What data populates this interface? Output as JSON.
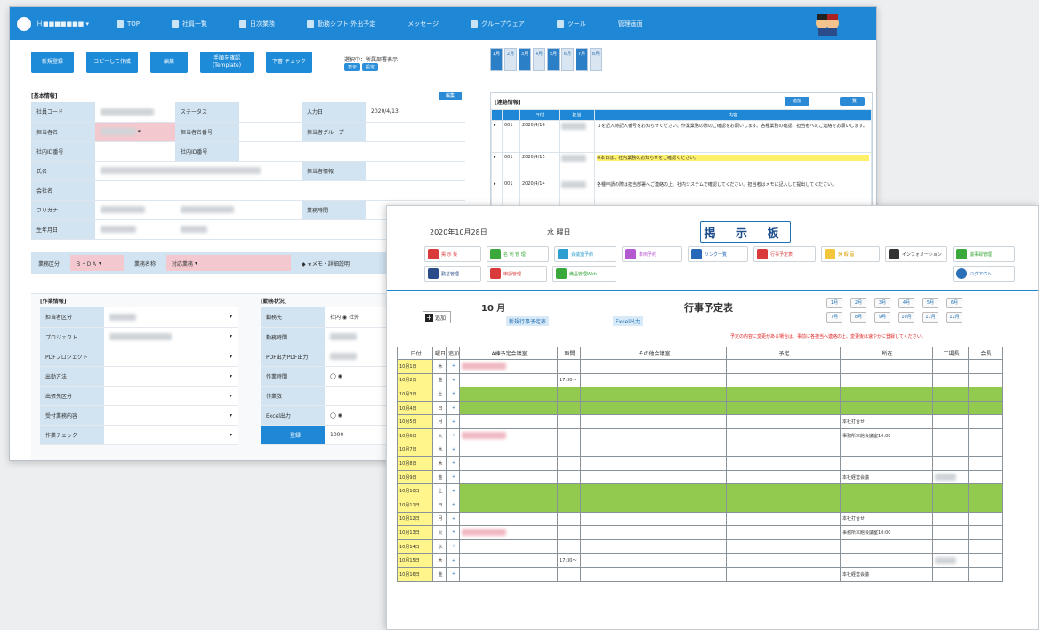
{
  "app": {
    "nav": {
      "user": "Ｈ■■■■■■■ ▾",
      "items": [
        "TOP",
        "社員一覧",
        "日次業務",
        "勤務シフト 外出予定",
        "メッセージ",
        "グループウェア",
        "ツール",
        "管理画面"
      ]
    },
    "buttons": [
      "新規登録",
      "コピーして作成",
      "編集",
      "手順を確認 (Template)",
      "下書 チェック"
    ],
    "sel": {
      "label": "選択中：所属部署表示",
      "tags": [
        "表示",
        "設定"
      ]
    },
    "months": [
      "1月",
      "2月",
      "3月",
      "4月",
      "5月",
      "6月",
      "7月",
      "8月"
    ],
    "basic": {
      "title": "[基本情報]",
      "btn": "編集",
      "rows": [
        {
          "a": "社員コード",
          "b": "",
          "c": "ステータス",
          "d": "",
          "e": "入力日",
          "f": "2020/4/13"
        },
        {
          "a": "担当者名",
          "b": "",
          "c": "担当者名番号",
          "d": "",
          "e": "担当者グループ",
          "f": ""
        },
        {
          "a": "社内ID番号",
          "b": "",
          "c": "社内ID番号",
          "d": "",
          "e": "",
          "f": ""
        },
        {
          "a": "氏名",
          "b": "",
          "c": "",
          "d": "",
          "e": "担当者情報",
          "f": ""
        },
        {
          "a": "会社名",
          "b": "",
          "c": "",
          "d": "",
          "e": "",
          "f": ""
        },
        {
          "a": "フリガナ",
          "b": "",
          "c": "",
          "d": "",
          "e": "業務時間",
          "f": ""
        },
        {
          "a": "生年月日",
          "b": "",
          "c": "",
          "d": "",
          "e": "",
          "f": ""
        }
      ]
    },
    "selrow": [
      "業務区分",
      "Ｂ・ＤＡ",
      "業務名称",
      "対応業務",
      "◆ ★メモ・詳細説明"
    ],
    "left": {
      "title": "[作業情報]",
      "rows": [
        "担当者区分",
        "プロジェクト",
        "PDFプロジェクト",
        "出勤方法",
        "出張先区分",
        "受付業務内容",
        "作業チェック"
      ]
    },
    "right": {
      "title": "[勤務状況]",
      "rows": [
        {
          "l": "勤務先",
          "v": "社内 ◉ 社外"
        },
        {
          "l": "勤務時間",
          "v": ""
        },
        {
          "l": "PDF出力PDF出力",
          "v": ""
        },
        {
          "l": "作業時間",
          "v": "◯ ◉"
        },
        {
          "l": "作業数",
          "v": ""
        },
        {
          "l": "Excel出力",
          "v": "◯ ◉"
        },
        {
          "l": "登録",
          "v": "1000"
        }
      ]
    },
    "notes": {
      "title": "[連絡情報]",
      "btns": [
        "追加",
        "一覧"
      ],
      "cols": [
        "",
        "",
        "日付",
        "担当",
        "内容"
      ],
      "rows": [
        {
          "n": "001",
          "d": "2020/4/16",
          "t": "１を記入時記入番号をお知らせください。作業業務の際のご確認をお願いします。各種業務の確認、担当者へのご連絡をお願いします。",
          "h": "※本日は、社内業務のお知らせをご確認ください。"
        },
        {
          "n": "001",
          "d": "2020/4/15",
          "t": "",
          "h": ""
        },
        {
          "n": "001",
          "d": "2020/4/14",
          "t": "各種申請の際は担当部署へご連絡の上、社内システムで確認してください。担当者はメモに記入して提出してください。",
          "h": ""
        }
      ]
    }
  },
  "board": {
    "date": "2020年10月28日",
    "dow": "水 曜日",
    "title": "掲 示 板",
    "apps": [
      "掲 示 板",
      "名 刺 管 理",
      "会議室予約",
      "車両予約",
      "リンク一覧",
      "行事予定表",
      "休 暇 届",
      "インフォメーション",
      "議事録管理",
      "勤怠管理",
      "申請管理",
      "備品管理Web",
      "ログアウト"
    ],
    "month": "10 月",
    "add": "追加",
    "links": [
      "新規行事予定表",
      "Excel出力"
    ],
    "schedtitle": "行事予定表",
    "mbtns": [
      "1月",
      "2月",
      "3月",
      "4月",
      "5月",
      "6月",
      "7月",
      "8月",
      "9月",
      "10月",
      "11月",
      "12月"
    ],
    "warn": "予定の内容に変更がある場合は、事前に各担当へ連絡の上、変更後は速やかに登録してください。",
    "head": [
      "日付",
      "曜日",
      "追加",
      "A棟予定会議室",
      "時間",
      "その他会議室",
      "予定",
      "所在",
      "工場長",
      "会長"
    ],
    "days": [
      {
        "d": "10月1日",
        "w": "木",
        "g": false,
        "a": "",
        "t": "",
        "o": "",
        "s": ""
      },
      {
        "d": "10月2日",
        "w": "金",
        "g": false,
        "a": "",
        "t": "17:30～",
        "o": "",
        "s": ""
      },
      {
        "d": "10月3日",
        "w": "土",
        "g": true,
        "a": "",
        "t": "",
        "o": "",
        "s": ""
      },
      {
        "d": "10月4日",
        "w": "日",
        "g": true,
        "a": "",
        "t": "",
        "o": "",
        "s": ""
      },
      {
        "d": "10月5日",
        "w": "月",
        "g": false,
        "a": "",
        "t": "",
        "o": "",
        "s": "本社打合せ"
      },
      {
        "d": "10月6日",
        "w": "火",
        "g": false,
        "a": "",
        "t": "",
        "o": "",
        "s": "事務所本館会議室10:00"
      },
      {
        "d": "10月7日",
        "w": "水",
        "g": false,
        "a": "",
        "t": "",
        "o": "",
        "s": ""
      },
      {
        "d": "10月8日",
        "w": "木",
        "g": false,
        "a": "",
        "t": "",
        "o": "",
        "s": ""
      },
      {
        "d": "10月9日",
        "w": "金",
        "g": false,
        "a": "",
        "t": "",
        "o": "",
        "s": "本社経営会議"
      },
      {
        "d": "10月10日",
        "w": "土",
        "g": true,
        "a": "",
        "t": "",
        "o": "",
        "s": ""
      },
      {
        "d": "10月11日",
        "w": "日",
        "g": true,
        "a": "",
        "t": "",
        "o": "",
        "s": ""
      },
      {
        "d": "10月12日",
        "w": "月",
        "g": false,
        "a": "",
        "t": "",
        "o": "",
        "s": "本社打合せ"
      },
      {
        "d": "10月13日",
        "w": "火",
        "g": false,
        "a": "",
        "t": "",
        "o": "",
        "s": "事務所本館会議室10:00"
      },
      {
        "d": "10月14日",
        "w": "水",
        "g": false,
        "a": "",
        "t": "",
        "o": "",
        "s": ""
      },
      {
        "d": "10月15日",
        "w": "木",
        "g": false,
        "a": "",
        "t": "17:30～",
        "o": "",
        "s": ""
      },
      {
        "d": "10月16日",
        "w": "金",
        "g": false,
        "a": "",
        "t": "",
        "o": "",
        "s": "本社経営会議"
      }
    ]
  }
}
